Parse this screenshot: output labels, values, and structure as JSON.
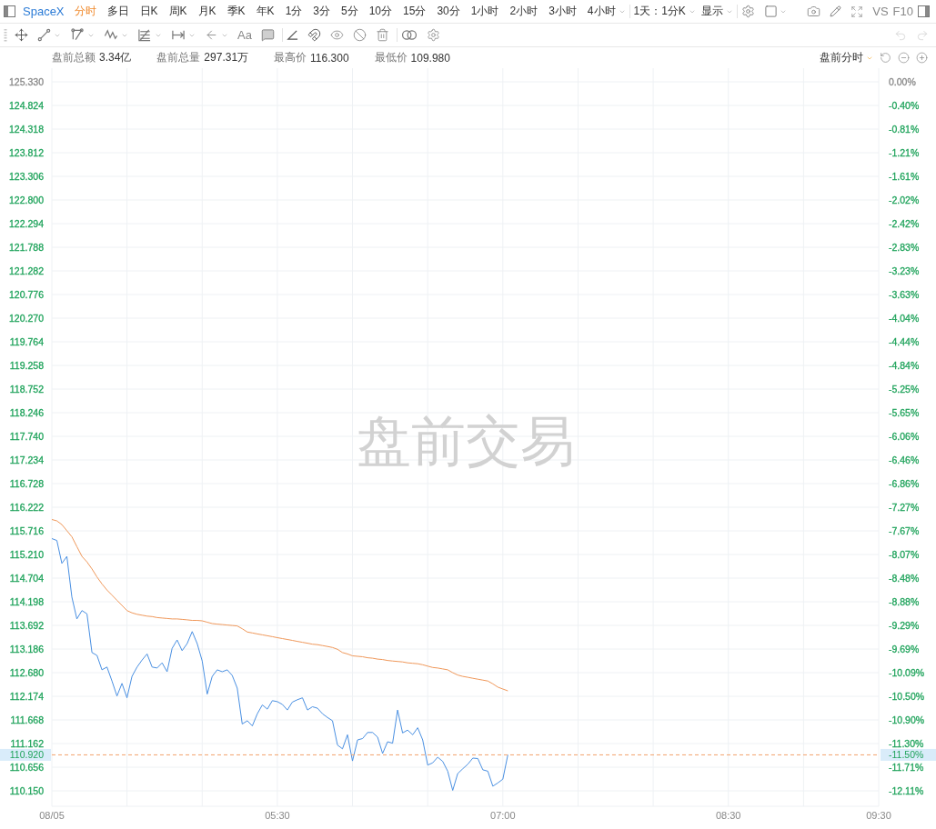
{
  "toolbar": {
    "symbol": "SpaceX",
    "periods": [
      {
        "label": "分时",
        "selected": true,
        "has_menu": false
      },
      {
        "label": "多日",
        "selected": false,
        "has_menu": false
      },
      {
        "label": "日K",
        "selected": false,
        "has_menu": false
      },
      {
        "label": "周K",
        "selected": false,
        "has_menu": false
      },
      {
        "label": "月K",
        "selected": false,
        "has_menu": false
      },
      {
        "label": "季K",
        "selected": false,
        "has_menu": false
      },
      {
        "label": "年K",
        "selected": false,
        "has_menu": false
      },
      {
        "label": "1分",
        "selected": false,
        "has_menu": false
      },
      {
        "label": "3分",
        "selected": false,
        "has_menu": false
      },
      {
        "label": "5分",
        "selected": false,
        "has_menu": false
      },
      {
        "label": "10分",
        "selected": false,
        "has_menu": false
      },
      {
        "label": "15分",
        "selected": false,
        "has_menu": false
      },
      {
        "label": "30分",
        "selected": false,
        "has_menu": false
      },
      {
        "label": "1小时",
        "selected": false,
        "has_menu": false
      },
      {
        "label": "2小时",
        "selected": false,
        "has_menu": false
      },
      {
        "label": "3小时",
        "selected": false,
        "has_menu": false
      },
      {
        "label": "4小时",
        "selected": false,
        "has_menu": true
      }
    ],
    "range_menu": "1天：1分K",
    "display_menu": "显示",
    "compare_button": "VS",
    "f10_button": "F10"
  },
  "drawing_toolbar": {
    "text_tool": "Aa",
    "undo": {
      "disabled": true
    },
    "redo": {
      "disabled": true
    }
  },
  "info_bar": {
    "stats": [
      {
        "label": "盘前总额",
        "value": "3.34亿"
      },
      {
        "label": "盘前总量",
        "value": "297.31万"
      },
      {
        "label": "最高价",
        "value": "116.300"
      },
      {
        "label": "最低价",
        "value": "109.980"
      }
    ],
    "mode_menu": "盘前分时"
  },
  "chart": {
    "session_label": "盘前交易",
    "current_price": {
      "price": "110.920",
      "change": "-11.50%"
    },
    "change_scale": [
      {
        "label": "0.00%",
        "color": "#888888"
      },
      {
        "label": "-0.40%",
        "color": "#1fa35b"
      },
      {
        "label": "-0.81%",
        "color": "#1fa35b"
      },
      {
        "label": "-1.21%",
        "color": "#1fa35b"
      },
      {
        "label": "-1.61%",
        "color": "#1fa35b"
      },
      {
        "label": "-2.02%",
        "color": "#1fa35b"
      },
      {
        "label": "-2.42%",
        "color": "#1fa35b"
      },
      {
        "label": "-2.83%",
        "color": "#1fa35b"
      },
      {
        "label": "-3.23%",
        "color": "#1fa35b"
      },
      {
        "label": "-3.63%",
        "color": "#1fa35b"
      },
      {
        "label": "-4.04%",
        "color": "#1fa35b"
      },
      {
        "label": "-4.44%",
        "color": "#1fa35b"
      },
      {
        "label": "-4.84%",
        "color": "#1fa35b"
      },
      {
        "label": "-5.25%",
        "color": "#1fa35b"
      },
      {
        "label": "-5.65%",
        "color": "#1fa35b"
      },
      {
        "label": "-6.06%",
        "color": "#1fa35b"
      },
      {
        "label": "-6.46%",
        "color": "#1fa35b"
      },
      {
        "label": "-6.86%",
        "color": "#1fa35b"
      },
      {
        "label": "-7.27%",
        "color": "#1fa35b"
      },
      {
        "label": "-7.67%",
        "color": "#1fa35b"
      },
      {
        "label": "-8.07%",
        "color": "#1fa35b"
      },
      {
        "label": "-8.48%",
        "color": "#1fa35b"
      },
      {
        "label": "-8.88%",
        "color": "#1fa35b"
      },
      {
        "label": "-9.29%",
        "color": "#1fa35b"
      },
      {
        "label": "-9.69%",
        "color": "#1fa35b"
      },
      {
        "label": "-10.09%",
        "color": "#1fa35b"
      },
      {
        "label": "-10.50%",
        "color": "#1fa35b"
      },
      {
        "label": "-10.90%",
        "color": "#1fa35b"
      },
      {
        "label": "-11.30%",
        "color": "#1fa35b"
      },
      {
        "label": "-11.71%",
        "color": "#1fa35b"
      },
      {
        "label": "-12.11%",
        "color": "#1fa35b"
      }
    ],
    "chart_data": {
      "type": "line",
      "grid": true,
      "ylim": [
        110.15,
        125.33
      ],
      "ref_lines": [
        {
          "axis": "y",
          "value": 110.92,
          "color": "#f2a36b"
        }
      ],
      "yticks": [
        {
          "value": 125.33,
          "label": "125.330"
        },
        {
          "value": 124.824,
          "label": "124.824"
        },
        {
          "value": 124.318,
          "label": "124.318"
        },
        {
          "value": 123.812,
          "label": "123.812"
        },
        {
          "value": 123.306,
          "label": "123.306"
        },
        {
          "value": 122.8,
          "label": "122.800"
        },
        {
          "value": 122.294,
          "label": "122.294"
        },
        {
          "value": 121.788,
          "label": "121.788"
        },
        {
          "value": 121.282,
          "label": "121.282"
        },
        {
          "value": 120.776,
          "label": "120.776"
        },
        {
          "value": 120.27,
          "label": "120.270"
        },
        {
          "value": 119.764,
          "label": "119.764"
        },
        {
          "value": 119.258,
          "label": "119.258"
        },
        {
          "value": 118.752,
          "label": "118.752"
        },
        {
          "value": 118.246,
          "label": "118.246"
        },
        {
          "value": 117.74,
          "label": "117.740"
        },
        {
          "value": 117.234,
          "label": "117.234"
        },
        {
          "value": 116.728,
          "label": "116.728"
        },
        {
          "value": 116.222,
          "label": "116.222"
        },
        {
          "value": 115.716,
          "label": "115.716"
        },
        {
          "value": 115.21,
          "label": "115.210"
        },
        {
          "value": 114.704,
          "label": "114.704"
        },
        {
          "value": 114.198,
          "label": "114.198"
        },
        {
          "value": 113.692,
          "label": "113.692"
        },
        {
          "value": 113.186,
          "label": "113.186"
        },
        {
          "value": 112.68,
          "label": "112.680"
        },
        {
          "value": 112.174,
          "label": "112.174"
        },
        {
          "value": 111.668,
          "label": "111.668"
        },
        {
          "value": 111.162,
          "label": "111.162"
        },
        {
          "value": 110.656,
          "label": "110.656"
        },
        {
          "value": 110.15,
          "label": "110.150"
        }
      ],
      "categories": [
        "08/05",
        null,
        null,
        null,
        null,
        null,
        null,
        null,
        null,
        null,
        null,
        null,
        null,
        null,
        null,
        null,
        null,
        null,
        null,
        null,
        null,
        null,
        null,
        null,
        null,
        null,
        null,
        null,
        null,
        null,
        null,
        null,
        null,
        null,
        null,
        null,
        null,
        null,
        null,
        null,
        null,
        null,
        null,
        null,
        null,
        "05:30",
        null,
        null,
        null,
        null,
        null,
        null,
        null,
        null,
        null,
        null,
        null,
        null,
        null,
        null,
        null,
        null,
        null,
        null,
        null,
        null,
        null,
        null,
        null,
        null,
        null,
        null,
        null,
        null,
        null,
        null,
        null,
        null,
        null,
        null,
        null,
        null,
        null,
        null,
        null,
        null,
        null,
        null,
        null,
        null,
        "07:00",
        null,
        null,
        null,
        null,
        null,
        null,
        null,
        null,
        null,
        null,
        null,
        null,
        null,
        null,
        null,
        null,
        null,
        null,
        null,
        null,
        null,
        null,
        null,
        null,
        null,
        null,
        null,
        null,
        null,
        null,
        null,
        null,
        null,
        null,
        null,
        null,
        null,
        null,
        null,
        null,
        null,
        null,
        null,
        null,
        "08:30",
        null,
        null,
        null,
        null,
        null,
        null,
        null,
        null,
        null,
        null,
        null,
        null,
        null,
        null,
        null,
        null,
        null,
        null,
        null,
        null,
        null,
        null,
        null,
        null,
        null,
        null,
        null,
        null,
        null,
        "09:30"
      ],
      "series": [
        {
          "color": "#4a90e2",
          "values": [
            115.55,
            115.51,
            115.02,
            115.17,
            114.3,
            113.83,
            114.01,
            113.94,
            113.11,
            113.05,
            112.74,
            112.8,
            112.5,
            112.18,
            112.45,
            112.14,
            112.6,
            112.8,
            112.95,
            113.08,
            112.8,
            112.78,
            112.89,
            112.7,
            113.2,
            113.38,
            113.15,
            113.3,
            113.56,
            113.3,
            112.93,
            112.22,
            112.6,
            112.74,
            112.7,
            112.74,
            112.62,
            112.35,
            111.58,
            111.65,
            111.54,
            111.8,
            111.99,
            111.9,
            112.08,
            112.06,
            112.0,
            111.88,
            112.05,
            112.1,
            112.14,
            111.88,
            111.95,
            111.92,
            111.8,
            111.72,
            111.65,
            111.13,
            111.05,
            111.35,
            110.79,
            111.24,
            111.27,
            111.4,
            111.4,
            111.3,
            110.95,
            111.2,
            111.17,
            111.88,
            111.39,
            111.45,
            111.35,
            111.5,
            111.24,
            110.7,
            110.75,
            110.87,
            110.78,
            110.57,
            110.16,
            110.52,
            110.62,
            110.72,
            110.85,
            110.84,
            110.6,
            110.57,
            110.25,
            110.32,
            110.4,
            110.92,
            null,
            null,
            null,
            null,
            null,
            null,
            null,
            null,
            null,
            null,
            null,
            null,
            null,
            null,
            null,
            null,
            null,
            null,
            null,
            null,
            null,
            null,
            null,
            null,
            null,
            null,
            null,
            null,
            null,
            null,
            null,
            null,
            null,
            null,
            null,
            null,
            null,
            null,
            null,
            null,
            null,
            null,
            null,
            null,
            null,
            null,
            null,
            null,
            null,
            null,
            null,
            null,
            null,
            null,
            null,
            null,
            null,
            null,
            null,
            null,
            null,
            null,
            null,
            null,
            null,
            null,
            null,
            null,
            null,
            null,
            null,
            null,
            null,
            null
          ]
        },
        {
          "color": "#f0985a",
          "values": [
            115.96,
            115.93,
            115.85,
            115.72,
            115.59,
            115.38,
            115.17,
            115.05,
            114.9,
            114.73,
            114.58,
            114.45,
            114.34,
            114.23,
            114.12,
            114.01,
            113.96,
            113.93,
            113.91,
            113.89,
            113.88,
            113.86,
            113.85,
            113.84,
            113.83,
            113.83,
            113.82,
            113.81,
            113.8,
            113.8,
            113.79,
            113.76,
            113.73,
            113.72,
            113.71,
            113.7,
            113.69,
            113.68,
            113.62,
            113.55,
            113.53,
            113.51,
            113.49,
            113.47,
            113.45,
            113.43,
            113.41,
            113.39,
            113.37,
            113.35,
            113.33,
            113.31,
            113.29,
            113.28,
            113.26,
            113.24,
            113.22,
            113.18,
            113.11,
            113.08,
            113.04,
            113.03,
            113.02,
            113.0,
            112.99,
            112.97,
            112.96,
            112.94,
            112.93,
            112.92,
            112.91,
            112.89,
            112.88,
            112.87,
            112.85,
            112.82,
            112.79,
            112.78,
            112.76,
            112.74,
            112.68,
            112.63,
            112.6,
            112.58,
            112.56,
            112.54,
            112.52,
            112.5,
            112.44,
            112.37,
            112.33,
            112.29,
            null,
            null,
            null,
            null,
            null,
            null,
            null,
            null,
            null,
            null,
            null,
            null,
            null,
            null,
            null,
            null,
            null,
            null,
            null,
            null,
            null,
            null,
            null,
            null,
            null,
            null,
            null,
            null,
            null,
            null,
            null,
            null,
            null,
            null,
            null,
            null,
            null,
            null,
            null,
            null,
            null,
            null,
            null,
            null,
            null,
            null,
            null,
            null,
            null,
            null,
            null,
            null,
            null,
            null,
            null,
            null,
            null,
            null,
            null,
            null,
            null,
            null,
            null,
            null,
            null,
            null,
            null,
            null,
            null,
            null,
            null,
            null,
            null,
            null
          ]
        }
      ]
    }
  }
}
